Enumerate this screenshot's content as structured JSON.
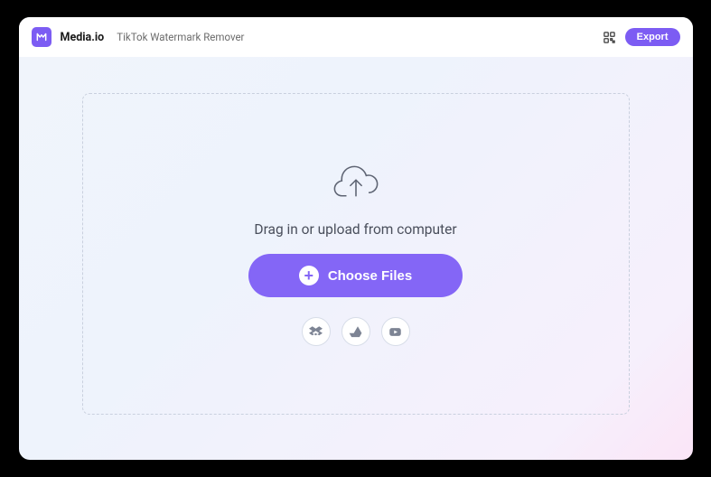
{
  "header": {
    "brand": "Media.io",
    "product": "TikTok Watermark Remover",
    "export_label": "Export"
  },
  "dropzone": {
    "instruction": "Drag in or upload from computer",
    "choose_label": "Choose Files"
  },
  "sources": {
    "dropbox": "dropbox",
    "gdrive": "google-drive",
    "youtube": "youtube"
  }
}
